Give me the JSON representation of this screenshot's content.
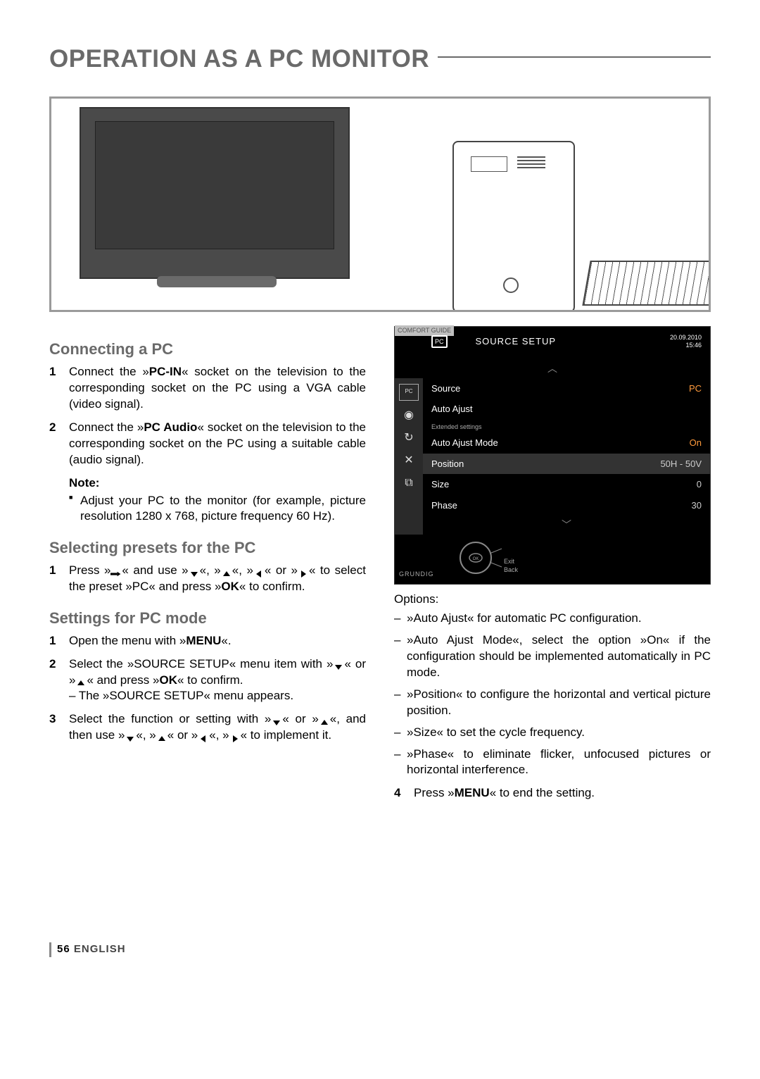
{
  "title": "OPERATION AS A PC MONITOR",
  "section1": {
    "heading": "Connecting a PC",
    "step1_a": "Connect the »",
    "step1_b": "PC-IN",
    "step1_c": "« socket on the television to the corresponding socket on the PC using a VGA cable (video signal).",
    "step2_a": "Connect the »",
    "step2_b": "PC Audio",
    "step2_c": "« socket on the television to the corresponding socket on the PC using a suitable cable (audio signal).",
    "note_label": "Note:",
    "note_body": "Adjust your PC to the monitor (for example, picture resolution 1280 x 768, picture frequency 60 Hz)."
  },
  "section2": {
    "heading": "Selecting presets for the PC",
    "step1_a": "Press »",
    "step1_b": "« and use »",
    "step1_c": "«, »",
    "step1_d": "«, »",
    "step1_e": "« or »",
    "step1_f": "« to select the preset »PC« and press »",
    "ok": "OK",
    "step1_g": "« to confirm."
  },
  "section3": {
    "heading": "Settings for PC mode",
    "step1_a": "Open the menu with »",
    "menu": "MENU",
    "step1_b": "«.",
    "step2_a": " Select the »SOURCE SETUP« menu item with »",
    "step2_b": "« or »",
    "step2_c": "« and press »",
    "step2_d": "« to confirm.",
    "step2_sub": "– The »SOURCE SETUP« menu appears.",
    "step3_a": "Select the function or setting with »",
    "step3_b": "« or »",
    "step3_c": "«, and then use »",
    "step3_d": "«, »",
    "step3_e": "« or »",
    "step3_f": "«, »",
    "step3_g": "« to implement it."
  },
  "osd": {
    "tab": "COMFORT GUIDE",
    "title": "SOURCE SETUP",
    "date": "20.09.2010",
    "time": "15:46",
    "row_source_label": "Source",
    "row_source_val": "PC",
    "row_autoajust_label": "Auto Ajust",
    "ext": "Extended settings",
    "row_mode_label": "Auto Ajust Mode",
    "row_mode_val": "On",
    "row_pos_label": "Position",
    "row_pos_val": "50H - 50V",
    "row_size_label": "Size",
    "row_size_val": "0",
    "row_phase_label": "Phase",
    "row_phase_val": "30",
    "exit": "Exit",
    "back": "Back",
    "brand": "GRUNDIG"
  },
  "options": {
    "label": "Options:",
    "o1": "»Auto Ajust« for automatic PC configuration.",
    "o2": "»Auto Ajust Mode«, select the option »On« if the configuration should be implemented automatically in PC mode.",
    "o3": "»Position« to configure the horizontal and vertical picture position.",
    "o4": "»Size« to set the cycle frequency.",
    "o5": "»Phase« to eliminate flicker, unfocused pictures or horizontal interference.",
    "step4_a": "Press »",
    "step4_b": "« to end the setting."
  },
  "footer": {
    "page": "56",
    "lang": "ENGLISH"
  }
}
